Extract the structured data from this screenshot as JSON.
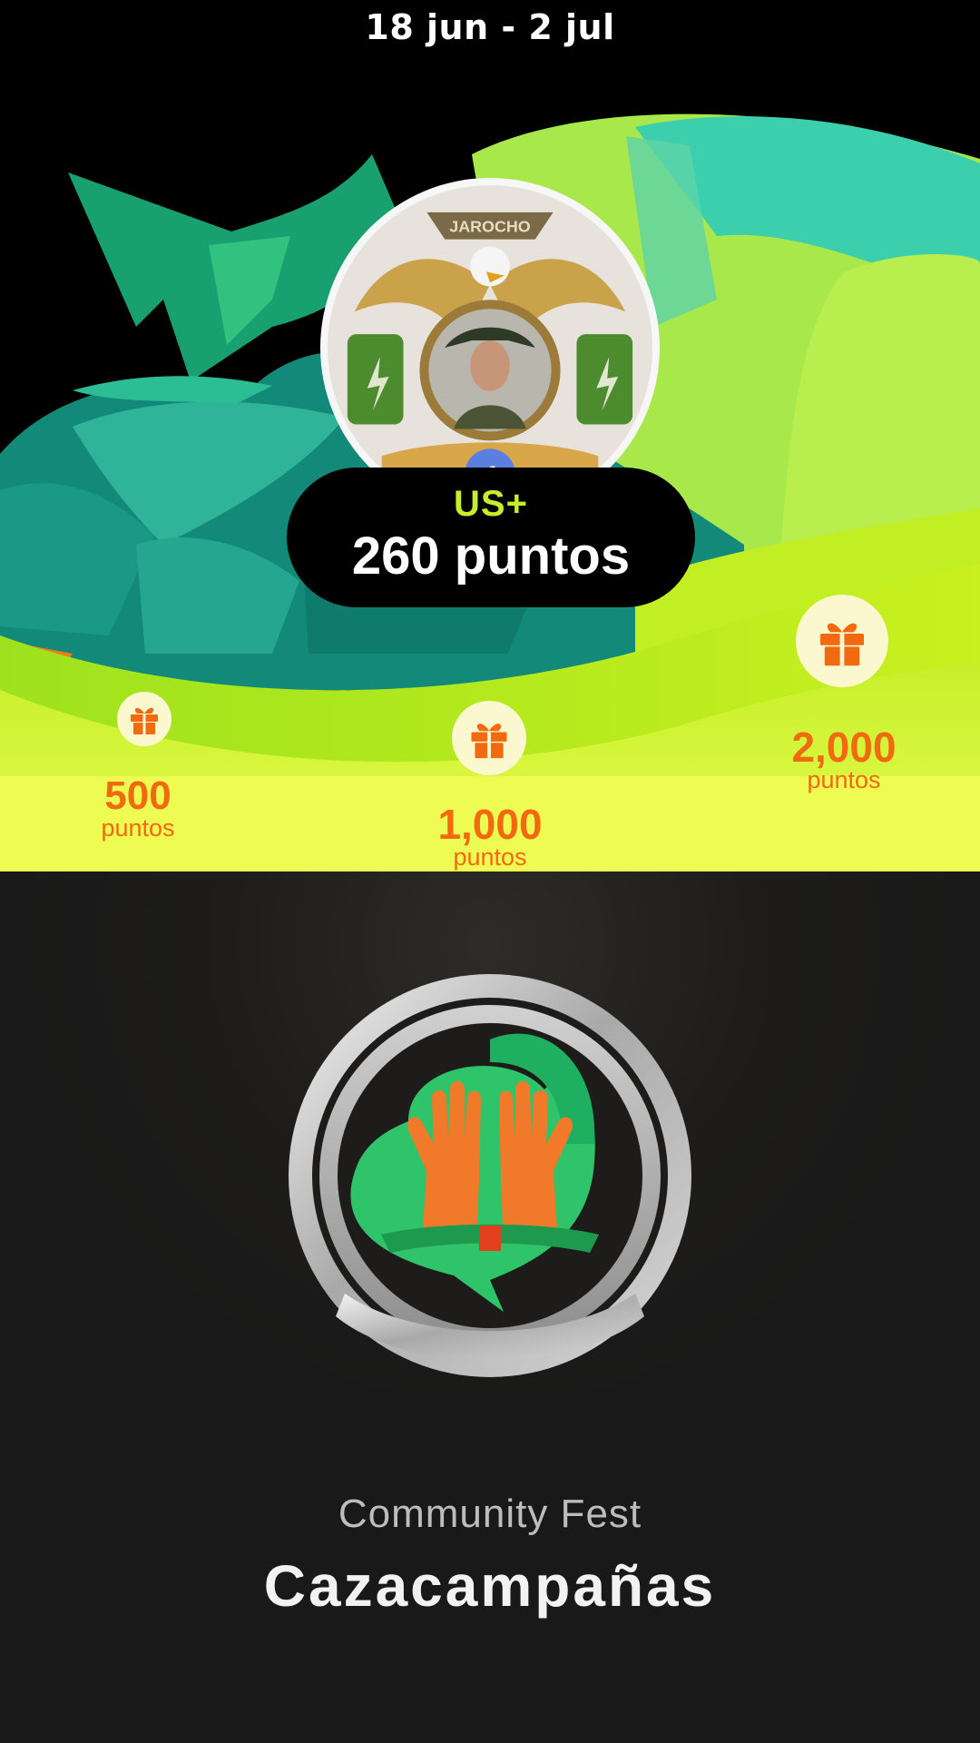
{
  "header": {
    "date_range": "18 jun - 2 jul"
  },
  "profile": {
    "avatar_icon": "user-avatar-badge-icon",
    "tier": "US+",
    "points_label": "260 puntos"
  },
  "milestones": [
    {
      "value": "500",
      "unit": "puntos",
      "icon": "gift-icon"
    },
    {
      "value": "1,000",
      "unit": "puntos",
      "icon": "gift-icon"
    },
    {
      "value": "2,000",
      "unit": "puntos",
      "icon": "gift-icon"
    }
  ],
  "badge": {
    "icon": "community-hands-badge-icon",
    "subtitle": "Community Fest",
    "title": "Cazacampañas"
  },
  "colors": {
    "accent_lime": "#c8ee2a",
    "accent_orange": "#f26a10",
    "teal_dark": "#0f7e72",
    "green": "#2fc46a",
    "badge_silver": "#c9c9c9"
  }
}
